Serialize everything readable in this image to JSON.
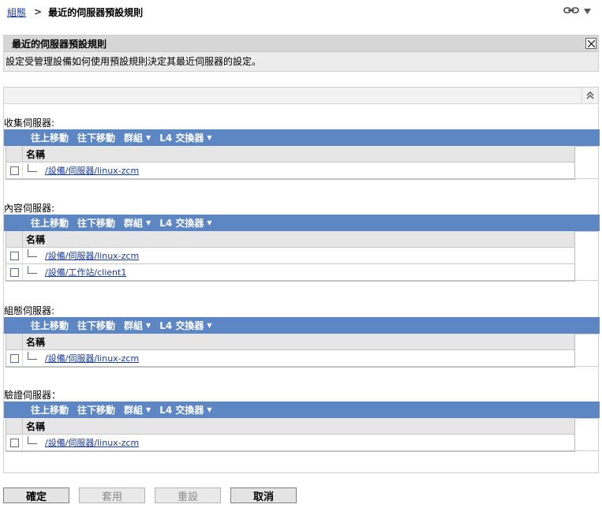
{
  "breadcrumb": {
    "parent": "組態",
    "separator": ">",
    "current": "最近的伺服器預設規則"
  },
  "banner": {
    "title": "最近的伺服器預設規則",
    "description": "設定受管理設備如何使用預設規則決定其最近伺服器的設定。"
  },
  "toolbar": {
    "move_up": "往上移動",
    "move_down": "往下移動",
    "group": "群組",
    "l4_switch": "L4 交換器"
  },
  "grid": {
    "name_header": "名稱"
  },
  "sections": [
    {
      "label": "收集伺服器:",
      "rows": [
        "/設備/伺服器/linux-zcm"
      ]
    },
    {
      "label": "內容伺服器:",
      "rows": [
        "/設備/伺服器/linux-zcm",
        "/設備/工作站/client1"
      ]
    },
    {
      "label": "組態伺服器:",
      "rows": [
        "/設備/伺服器/linux-zcm"
      ]
    },
    {
      "label": "驗證伺服器：",
      "rows": [
        "/設備/伺服器/linux-zcm"
      ]
    }
  ],
  "buttons": {
    "ok": "確定",
    "apply": "套用",
    "reset": "重設",
    "cancel": "取消"
  },
  "colors": {
    "toolbar_bg": "#5d86c5",
    "link": "#1a3a9c"
  },
  "icons": {
    "link": "link-icon",
    "dropdown": "chevron-down-icon",
    "close": "close-icon",
    "collapse": "double-chevron-up-icon"
  }
}
